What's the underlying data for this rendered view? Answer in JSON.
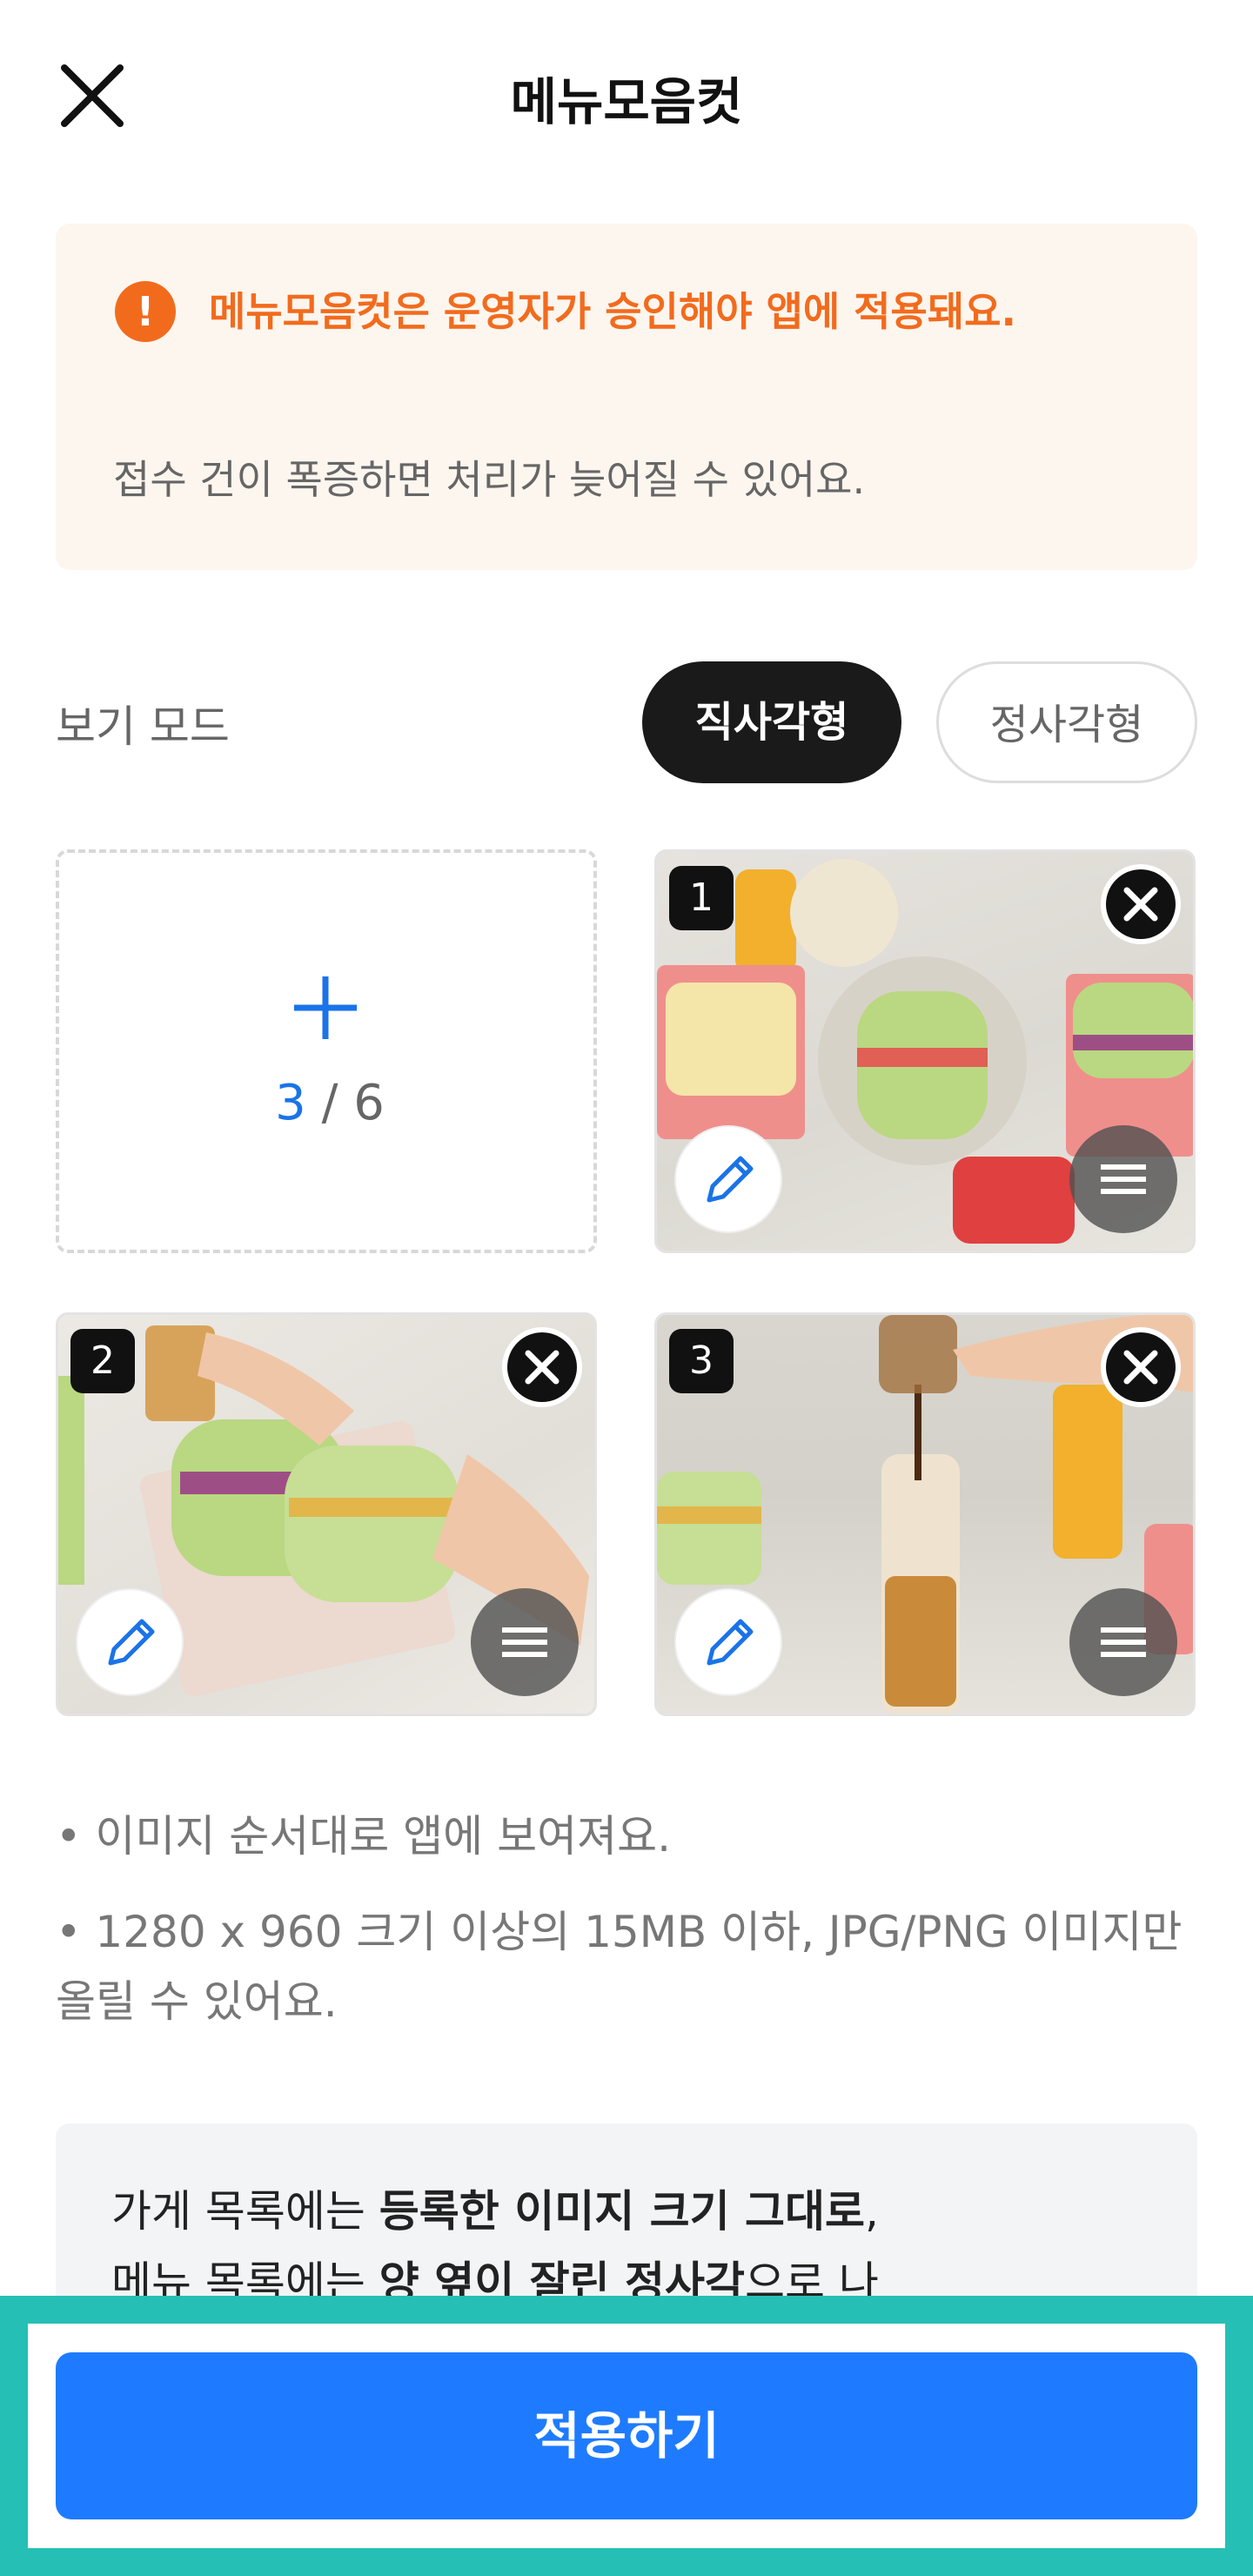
{
  "header": {
    "title": "메뉴모음컷"
  },
  "notice": {
    "title": "메뉴모음컷은 운영자가 승인해야 앱에 적용돼요.",
    "body": "접수 건이 폭증하면 처리가 늦어질 수 있어요."
  },
  "view_mode": {
    "label": "보기 모드",
    "options": [
      "직사각형",
      "정사각형"
    ],
    "selected": "직사각형"
  },
  "uploader": {
    "current": "3",
    "separator": " / ",
    "max": "6"
  },
  "photos": [
    {
      "number": "1",
      "subject": "sandwiches with juice bottles"
    },
    {
      "number": "2",
      "subject": "hands holding sandwich box"
    },
    {
      "number": "3",
      "subject": "pouring coffee into bottle"
    }
  ],
  "info": {
    "bullet1": "• 이미지 순서대로 앱에 보여져요.",
    "bullet2": "• 1280 x 960 크기 이상의 15MB 이하, JPG/PNG 이미지만 올릴 수 있어요."
  },
  "info_box": {
    "line1_prefix": "가게 목록에는 ",
    "line1_bold": "등록한 이미지 크기 그대로",
    "line1_suffix": ",",
    "line2_prefix": "메뉴 목록에는 ",
    "line2_bold": "양 옆이 잘린 정사각",
    "line2_suffix": "으로 나"
  },
  "footer": {
    "apply_label": "적용하기"
  },
  "colors": {
    "accent": "#1e7bff",
    "warning": "#f26b1d",
    "highlight": "#26bfb6"
  }
}
